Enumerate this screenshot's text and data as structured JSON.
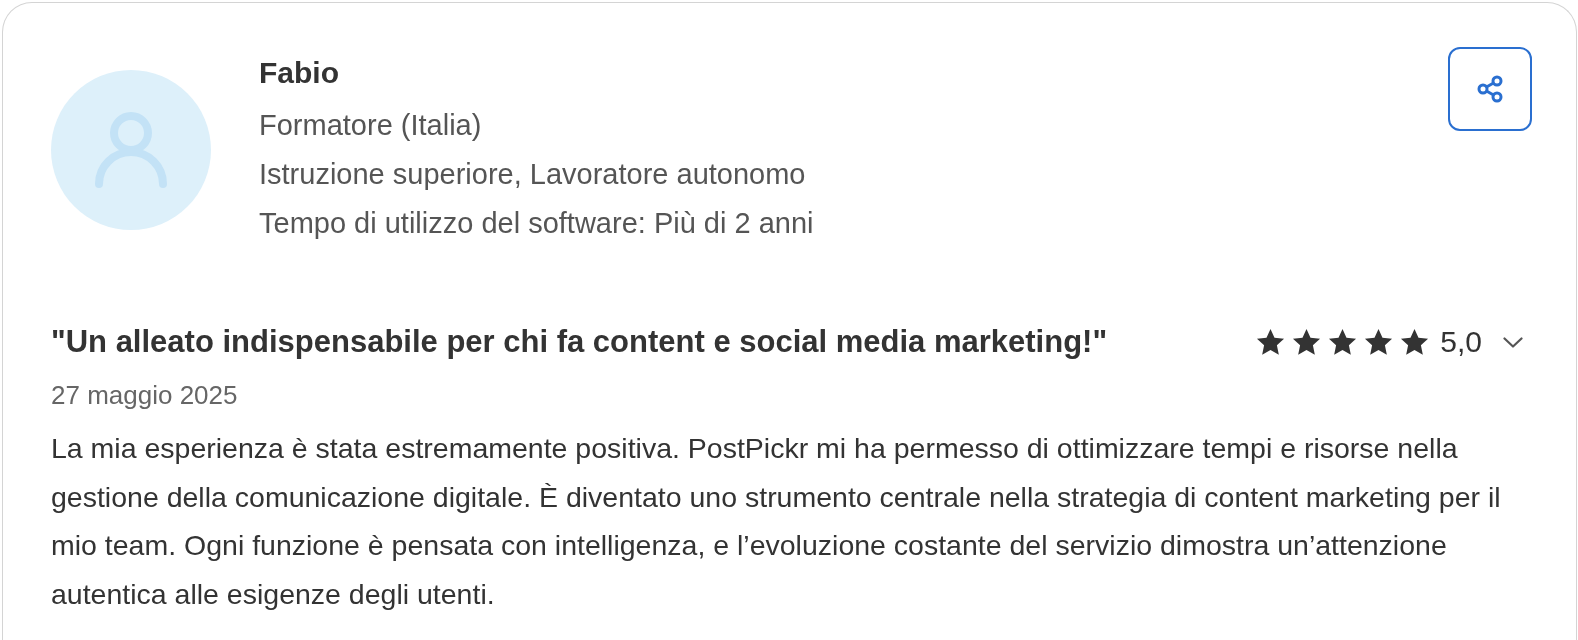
{
  "reviewer": {
    "name": "Fabio",
    "role": "Formatore (Italia)",
    "details": "Istruzione superiore, Lavoratore autonomo",
    "usage": "Tempo di utilizzo del software: Più di 2 anni"
  },
  "review": {
    "title": "\"Un alleato indispensabile per chi fa content e social media marketing!\"",
    "stars": 5,
    "rating": "5,0",
    "date": "27 maggio 2025",
    "body": "La mia esperienza è stata estremamente positiva. PostPickr mi ha permesso di ottimizzare tempi e risorse nella gestione della comunicazione digitale. È diventato uno strumento centrale nella strategia di content marketing per il mio team. Ogni funzione è pensata con intelligenza, e l’evoluzione costante del servizio dimostra un’attenzione autentica alle esigenze degli utenti."
  }
}
